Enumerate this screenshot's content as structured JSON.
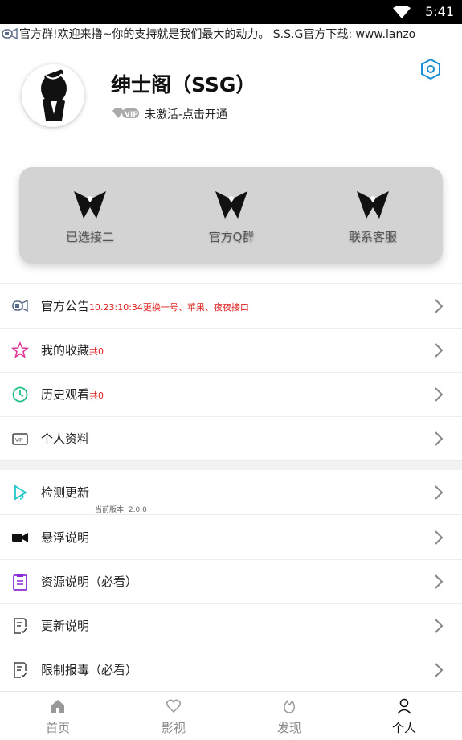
{
  "status_bar": {
    "time": "5:41"
  },
  "marquee": {
    "text": "官方群!欢迎来撸~你的支持就是我们最大的动力。 S.S.G官方下载: www.lanzo"
  },
  "profile": {
    "title": "绅士阁（SSG）",
    "vip_badge": "VIP",
    "status": "未激活-点击开通"
  },
  "quick_actions": [
    {
      "label": "已选接二"
    },
    {
      "label": "官方Q群"
    },
    {
      "label": "联系客服"
    }
  ],
  "menu_group1": [
    {
      "label": "官方公告",
      "note": "10.23:10:34更换一号、苹果、夜夜接口",
      "icon": "megaphone-icon"
    },
    {
      "label": "我的收藏",
      "note": "共0",
      "icon": "star-icon"
    },
    {
      "label": "历史观看",
      "note": "共0",
      "icon": "clock-icon"
    },
    {
      "label": "个人资料",
      "note": "",
      "icon": "vip-card-icon"
    }
  ],
  "menu_group2": [
    {
      "label": "检测更新",
      "sub": "当前版本: 2.0.0",
      "icon": "update-icon"
    },
    {
      "label": "悬浮说明",
      "icon": "video-camera-icon"
    },
    {
      "label": "资源说明（必看）",
      "icon": "clipboard-icon"
    },
    {
      "label": "更新说明",
      "icon": "document-check-icon"
    },
    {
      "label": "限制报毒（必看）",
      "icon": "document-check-icon"
    }
  ],
  "bottom_nav": [
    {
      "label": "首页",
      "icon": "home-icon"
    },
    {
      "label": "影视",
      "icon": "heart-icon"
    },
    {
      "label": "发现",
      "icon": "flame-icon"
    },
    {
      "label": "个人",
      "icon": "person-icon",
      "active": true
    }
  ],
  "colors": {
    "accent": "#1a8fd6",
    "note_red": "#e02020",
    "card_bg": "#d3d3d3"
  }
}
